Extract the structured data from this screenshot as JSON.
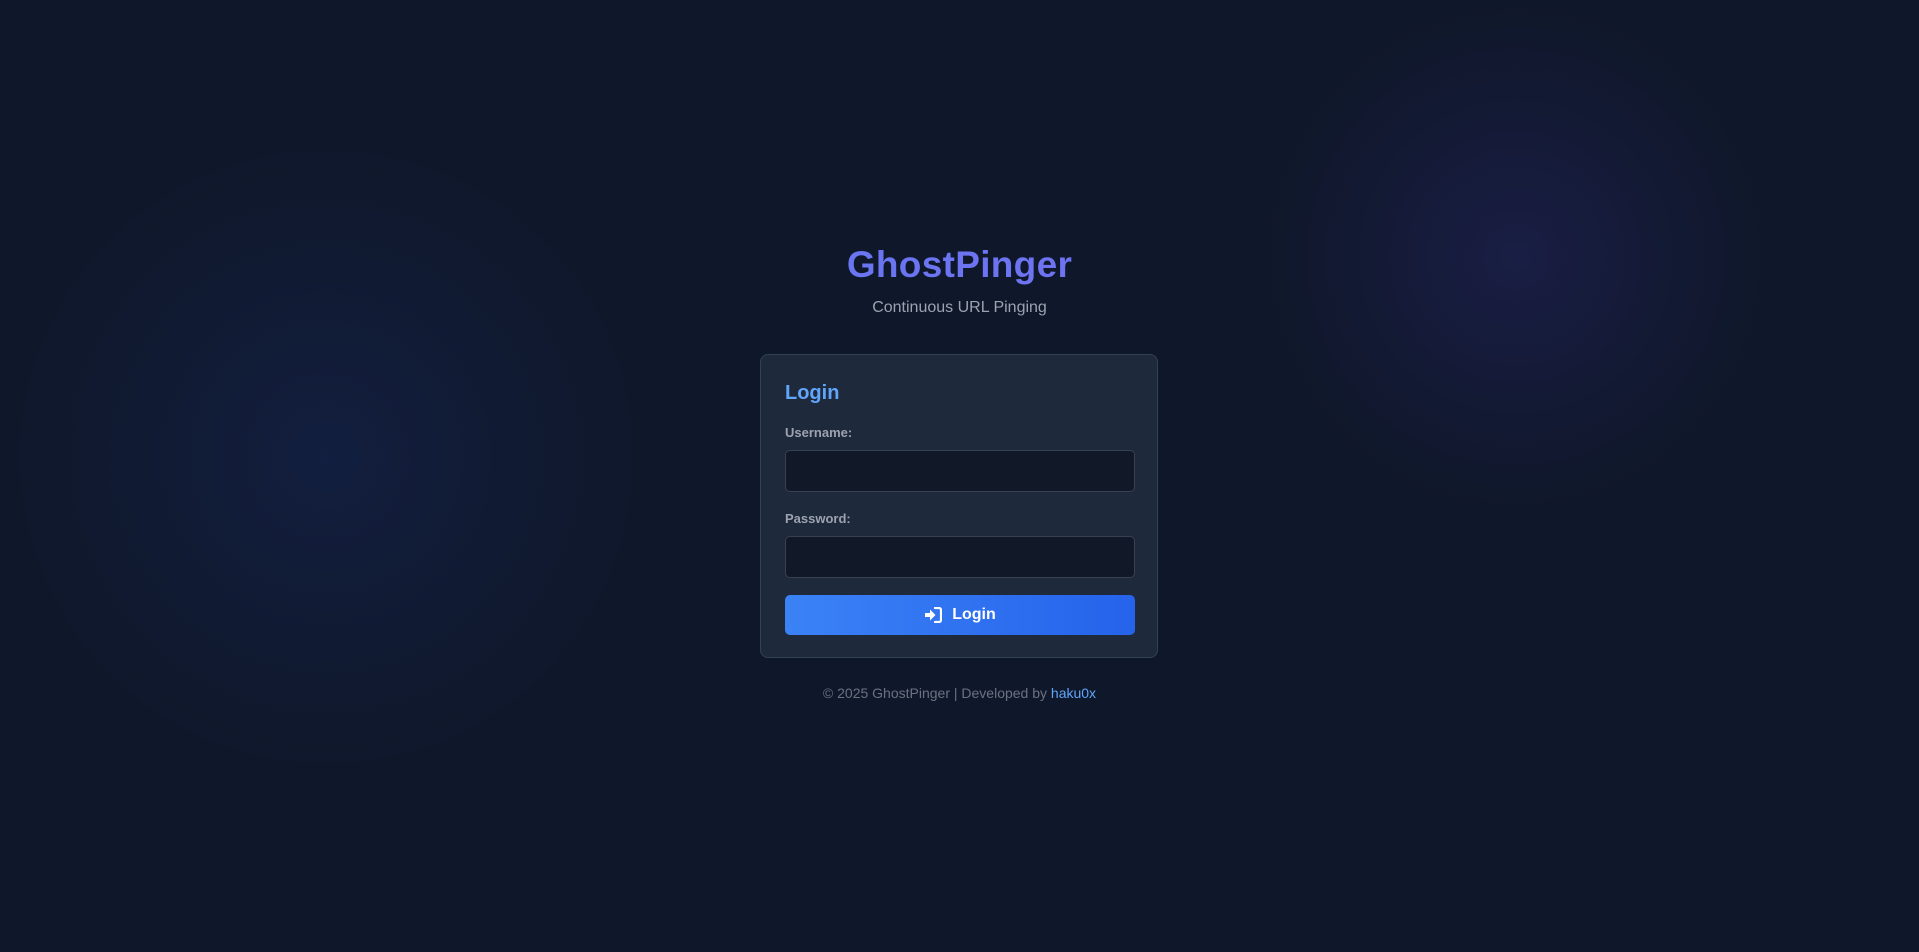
{
  "app": {
    "title": "GhostPinger",
    "tagline": "Continuous URL Pinging"
  },
  "login_form": {
    "heading": "Login",
    "username_label": "Username:",
    "username_value": "",
    "password_label": "Password:",
    "password_value": "",
    "submit_label": "Login",
    "submit_icon": "sign-in-icon"
  },
  "footer": {
    "text": "© 2025 GhostPinger | Developed by ",
    "author_link": "haku0x"
  },
  "colors": {
    "background": "#0f172a",
    "card": "#1e293b",
    "accent": "#3b82f6",
    "brand": "#6366f1",
    "link": "#60a5fa"
  }
}
